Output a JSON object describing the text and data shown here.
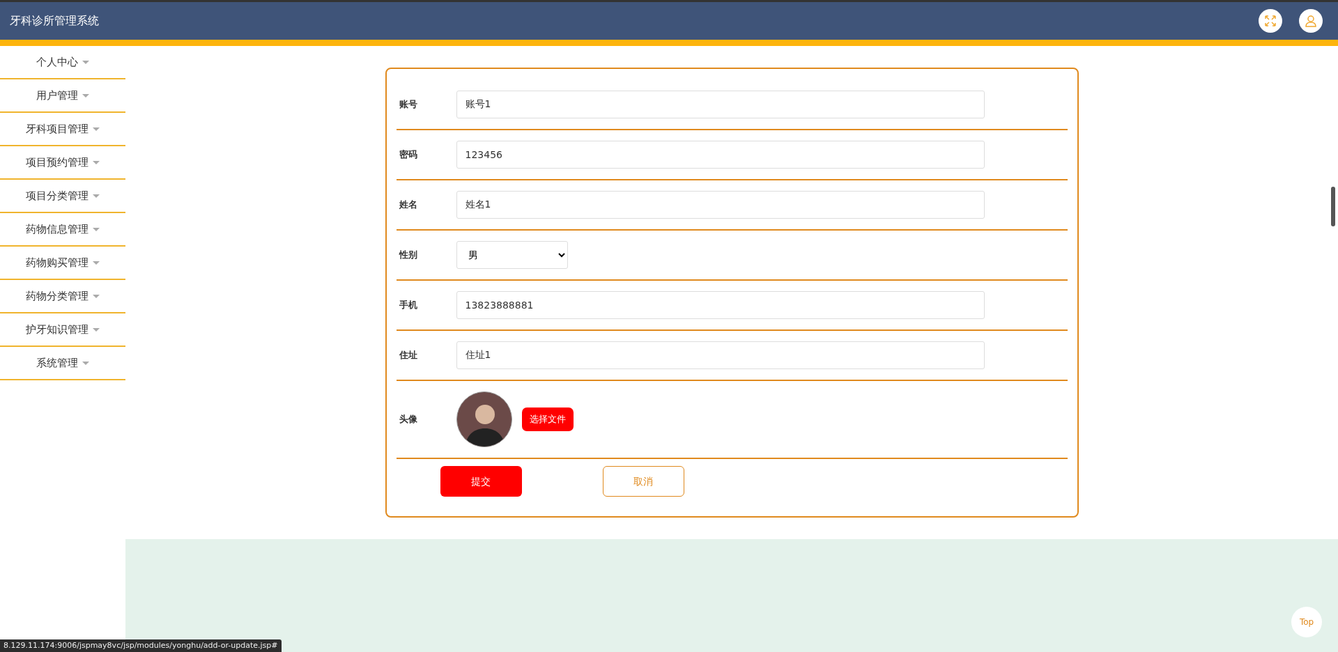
{
  "header": {
    "title": "牙科诊所管理系统"
  },
  "sidebar": {
    "items": [
      {
        "label": "个人中心"
      },
      {
        "label": "用户管理"
      },
      {
        "label": "牙科项目管理"
      },
      {
        "label": "项目预约管理"
      },
      {
        "label": "项目分类管理"
      },
      {
        "label": "药物信息管理"
      },
      {
        "label": "药物购买管理"
      },
      {
        "label": "药物分类管理"
      },
      {
        "label": "护牙知识管理"
      },
      {
        "label": "系统管理"
      }
    ]
  },
  "form": {
    "fields": [
      {
        "kind": "text",
        "label": "账号",
        "value": "账号1"
      },
      {
        "kind": "text",
        "label": "密码",
        "value": "123456"
      },
      {
        "kind": "text",
        "label": "姓名",
        "value": "姓名1"
      },
      {
        "kind": "select",
        "label": "性别",
        "value": "男"
      },
      {
        "kind": "text",
        "label": "手机",
        "value": "13823888881"
      },
      {
        "kind": "text",
        "label": "住址",
        "value": "住址1"
      },
      {
        "kind": "image",
        "label": "头像",
        "button": "选择文件"
      }
    ],
    "submit": "提交",
    "cancel": "取消"
  },
  "status_bar": {
    "url": "8.129.11.174:9006/jspmay8vc/jsp/modules/yonghu/add-or-update.jsp#"
  },
  "top_button": "Top"
}
